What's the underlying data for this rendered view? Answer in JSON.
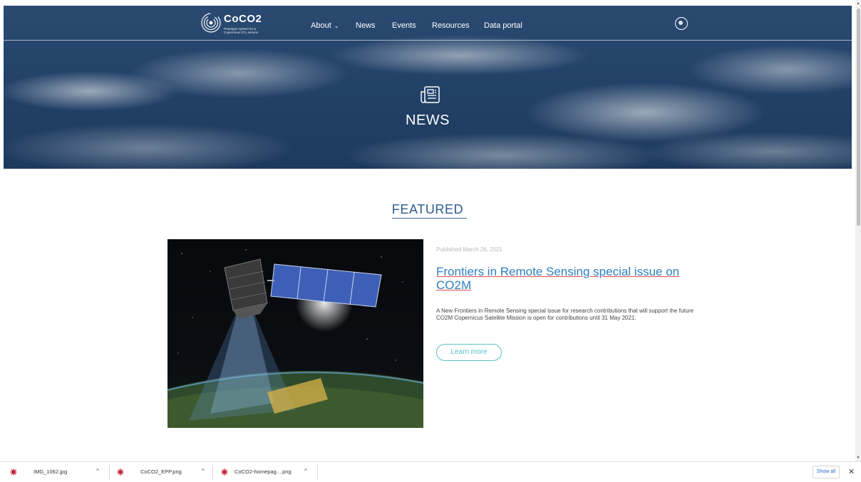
{
  "brand": {
    "name": "CoCO2",
    "tagline_line1": "Prototype system for a",
    "tagline_line2": "Copernicus CO₂ service"
  },
  "nav": {
    "items": [
      {
        "label": "About",
        "has_dropdown": true
      },
      {
        "label": "News"
      },
      {
        "label": "Events"
      },
      {
        "label": "Resources"
      },
      {
        "label": "Data portal"
      }
    ],
    "chevron": "⌄",
    "icon": "compass-icon"
  },
  "hero": {
    "icon": "newspaper-icon",
    "title": "NEWS"
  },
  "featured": {
    "heading": "FEATURED",
    "published": "Published March 26, 2021",
    "title": "Frontiers in Remote Sensing special issue on CO2M",
    "description": "A New Frontiers in Remote Sensing special issue for research contributions that will support the future CO2M Copernicus Satellite Mission is open for contributions until 31 May 2021.",
    "button_label": "Learn more",
    "image": "satellite-over-earth-image"
  },
  "downloads": {
    "items": [
      {
        "name": "IMG_1062.jpg",
        "caret": "^"
      },
      {
        "name": "CoCO2_EPP.png",
        "caret": "^"
      },
      {
        "name": "CoCO2-homepag....png",
        "caret": "^"
      }
    ],
    "show_all_label": "Show all",
    "close": "✕"
  },
  "colors": {
    "accent_blue": "#2e80c2",
    "teal": "#5ac0c6",
    "hero_navy": "#24436a"
  }
}
